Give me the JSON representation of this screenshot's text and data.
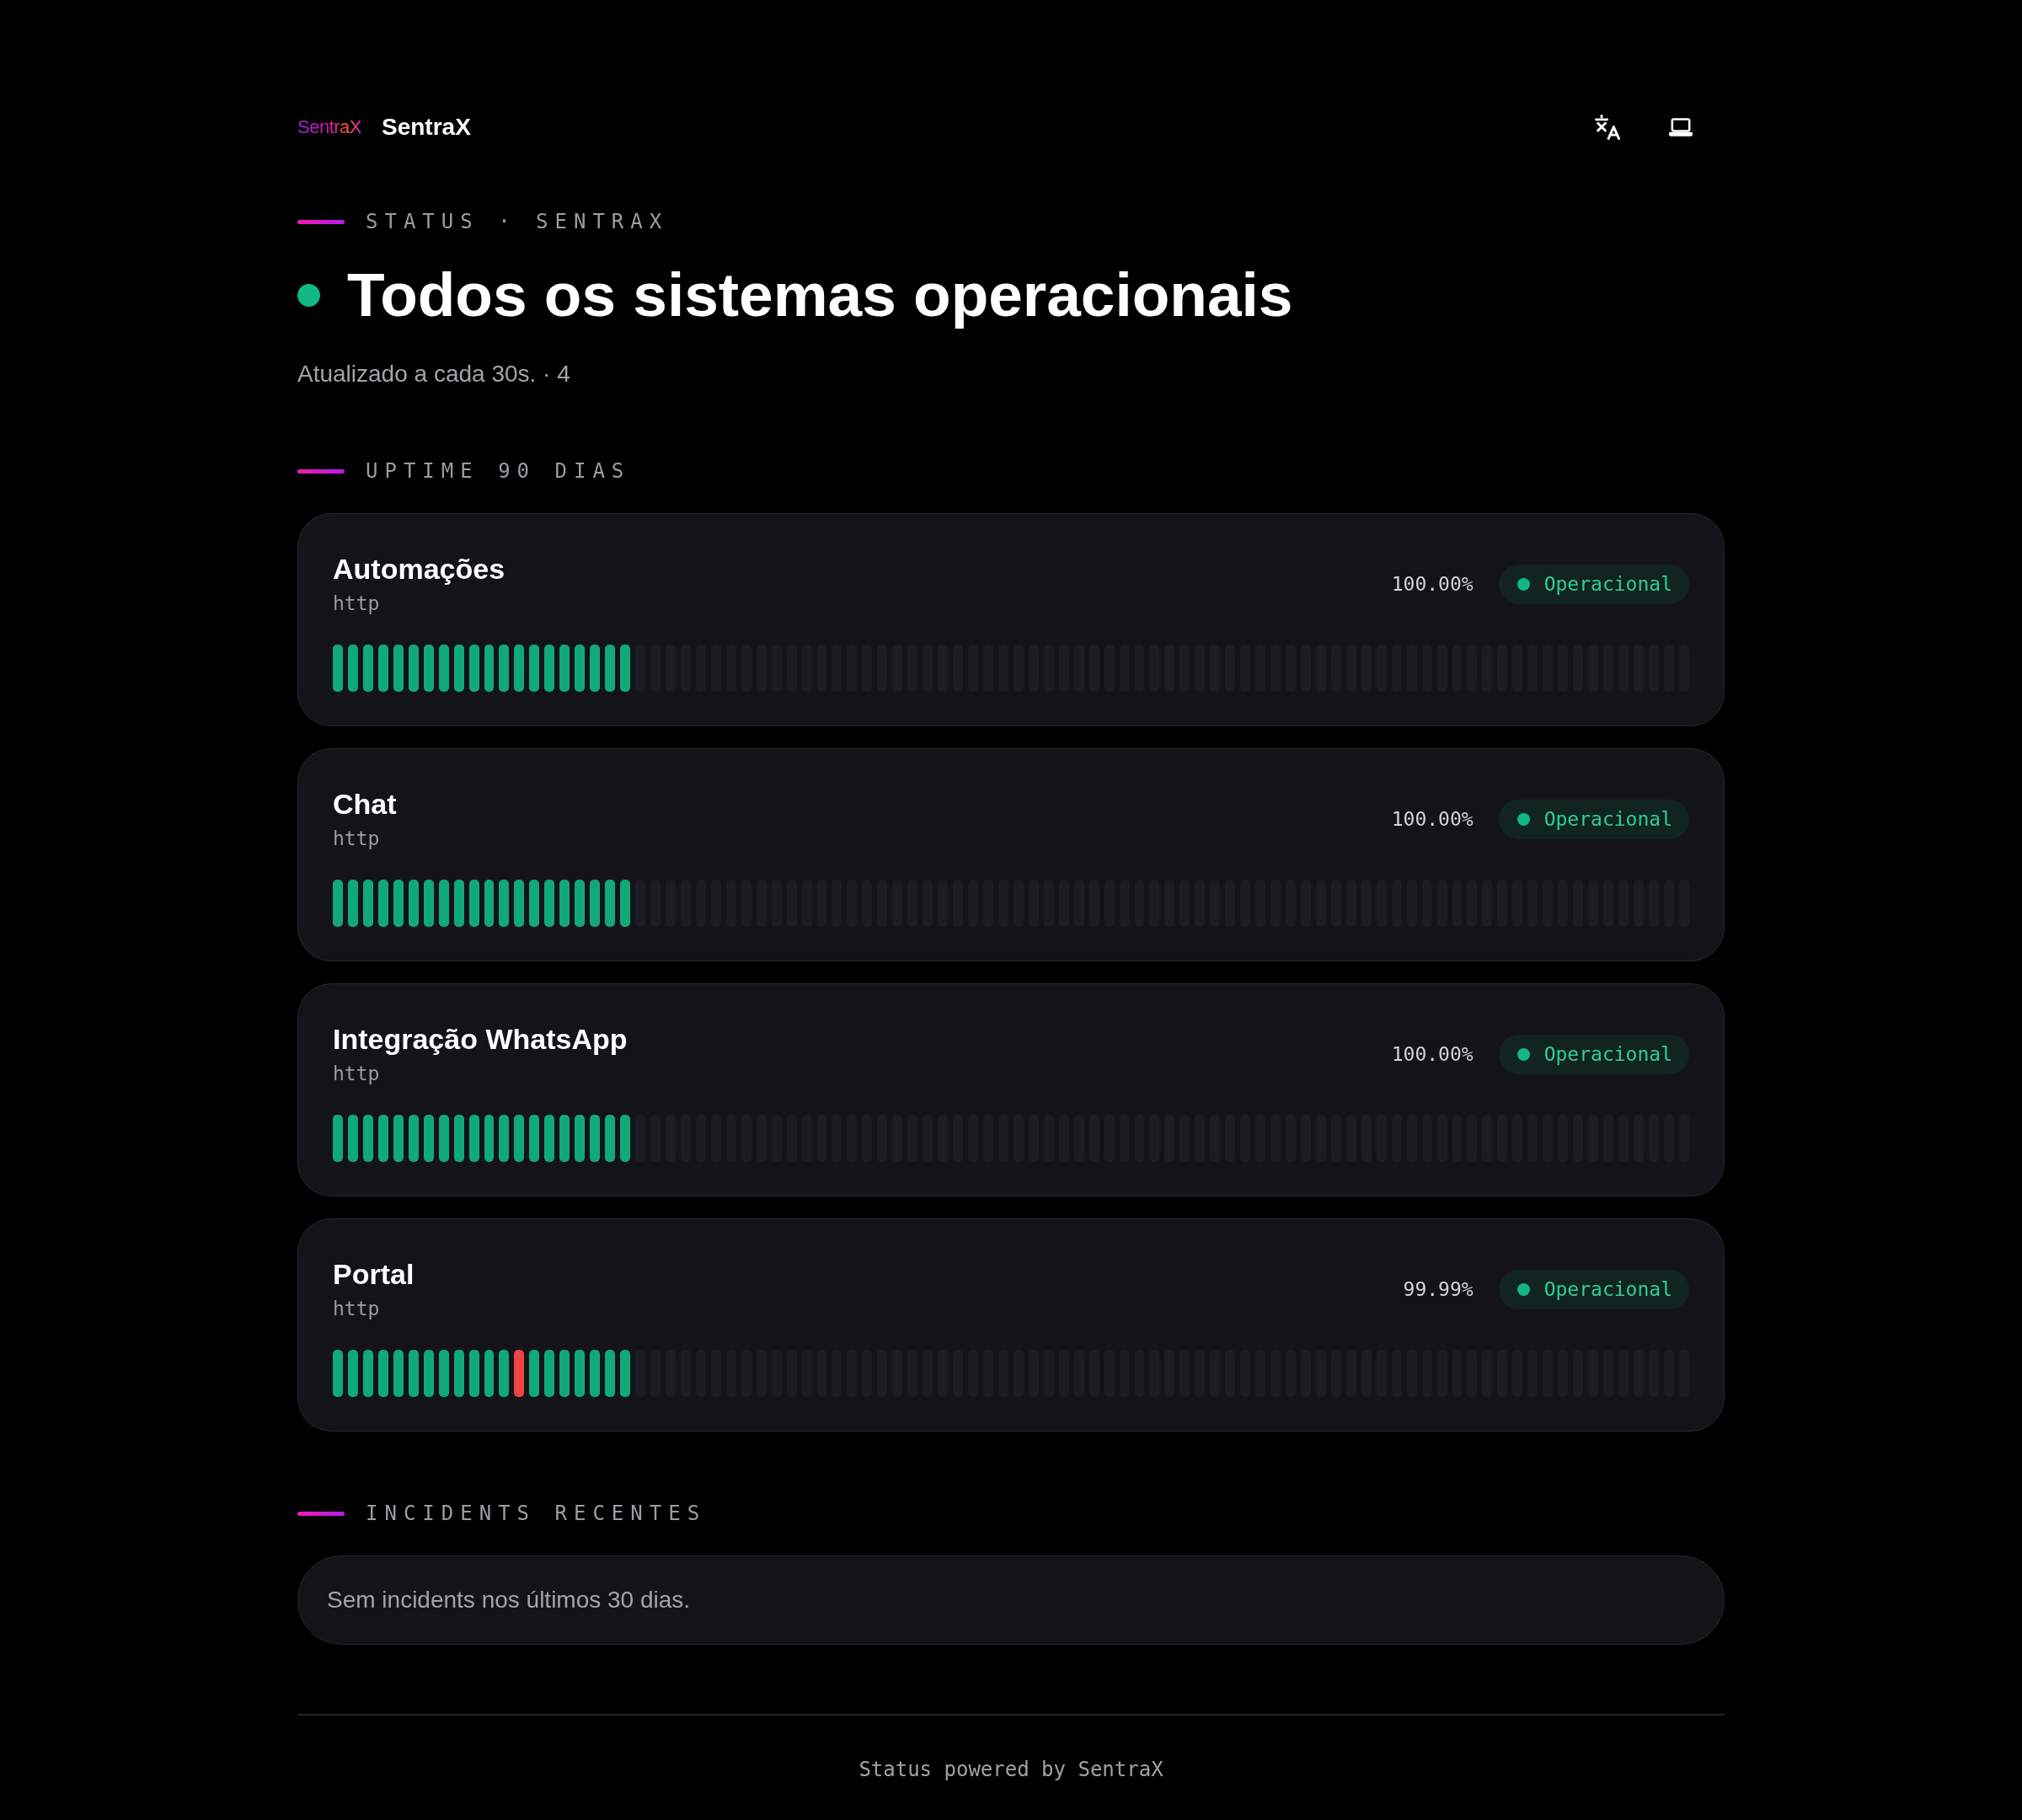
{
  "header": {
    "logo_text": "SentraX",
    "brand": "SentraX"
  },
  "status": {
    "label": "STATUS · SENTRAX",
    "kind": "operational",
    "title": "Todos os sistemas operacionais",
    "subtitle": "Atualizado a cada 30s. · 4"
  },
  "uptime": {
    "label": "UPTIME 90 DIAS",
    "services": [
      {
        "name": "Automações",
        "type": "http",
        "uptime": "100.00%",
        "status": {
          "kind": "operational",
          "label": "Operacional"
        },
        "days": [
          {
            "kind": "up"
          },
          {
            "kind": "up"
          },
          {
            "kind": "up"
          },
          {
            "kind": "up"
          },
          {
            "kind": "up"
          },
          {
            "kind": "up"
          },
          {
            "kind": "up"
          },
          {
            "kind": "up"
          },
          {
            "kind": "up"
          },
          {
            "kind": "up"
          },
          {
            "kind": "up"
          },
          {
            "kind": "up"
          },
          {
            "kind": "up"
          },
          {
            "kind": "up"
          },
          {
            "kind": "up"
          },
          {
            "kind": "up"
          },
          {
            "kind": "up"
          },
          {
            "kind": "up"
          },
          {
            "kind": "up"
          },
          {
            "kind": "up"
          },
          {
            "kind": "none"
          },
          {
            "kind": "none"
          },
          {
            "kind": "none"
          },
          {
            "kind": "none"
          },
          {
            "kind": "none"
          },
          {
            "kind": "none"
          },
          {
            "kind": "none"
          },
          {
            "kind": "none"
          },
          {
            "kind": "none"
          },
          {
            "kind": "none"
          },
          {
            "kind": "none"
          },
          {
            "kind": "none"
          },
          {
            "kind": "none"
          },
          {
            "kind": "none"
          },
          {
            "kind": "none"
          },
          {
            "kind": "none"
          },
          {
            "kind": "none"
          },
          {
            "kind": "none"
          },
          {
            "kind": "none"
          },
          {
            "kind": "none"
          },
          {
            "kind": "none"
          },
          {
            "kind": "none"
          },
          {
            "kind": "none"
          },
          {
            "kind": "none"
          },
          {
            "kind": "none"
          },
          {
            "kind": "none"
          },
          {
            "kind": "none"
          },
          {
            "kind": "none"
          },
          {
            "kind": "none"
          },
          {
            "kind": "none"
          },
          {
            "kind": "none"
          },
          {
            "kind": "none"
          },
          {
            "kind": "none"
          },
          {
            "kind": "none"
          },
          {
            "kind": "none"
          },
          {
            "kind": "none"
          },
          {
            "kind": "none"
          },
          {
            "kind": "none"
          },
          {
            "kind": "none"
          },
          {
            "kind": "none"
          },
          {
            "kind": "none"
          },
          {
            "kind": "none"
          },
          {
            "kind": "none"
          },
          {
            "kind": "none"
          },
          {
            "kind": "none"
          },
          {
            "kind": "none"
          },
          {
            "kind": "none"
          },
          {
            "kind": "none"
          },
          {
            "kind": "none"
          },
          {
            "kind": "none"
          },
          {
            "kind": "none"
          },
          {
            "kind": "none"
          },
          {
            "kind": "none"
          },
          {
            "kind": "none"
          },
          {
            "kind": "none"
          },
          {
            "kind": "none"
          },
          {
            "kind": "none"
          },
          {
            "kind": "none"
          },
          {
            "kind": "none"
          },
          {
            "kind": "none"
          },
          {
            "kind": "none"
          },
          {
            "kind": "none"
          },
          {
            "kind": "none"
          },
          {
            "kind": "none"
          },
          {
            "kind": "none"
          },
          {
            "kind": "none"
          },
          {
            "kind": "none"
          },
          {
            "kind": "none"
          },
          {
            "kind": "none"
          },
          {
            "kind": "none"
          }
        ]
      },
      {
        "name": "Chat",
        "type": "http",
        "uptime": "100.00%",
        "status": {
          "kind": "operational",
          "label": "Operacional"
        },
        "days": [
          {
            "kind": "up"
          },
          {
            "kind": "up"
          },
          {
            "kind": "up"
          },
          {
            "kind": "up"
          },
          {
            "kind": "up"
          },
          {
            "kind": "up"
          },
          {
            "kind": "up"
          },
          {
            "kind": "up"
          },
          {
            "kind": "up"
          },
          {
            "kind": "up"
          },
          {
            "kind": "up"
          },
          {
            "kind": "up"
          },
          {
            "kind": "up"
          },
          {
            "kind": "up"
          },
          {
            "kind": "up"
          },
          {
            "kind": "up"
          },
          {
            "kind": "up"
          },
          {
            "kind": "up"
          },
          {
            "kind": "up"
          },
          {
            "kind": "up"
          },
          {
            "kind": "none"
          },
          {
            "kind": "none"
          },
          {
            "kind": "none"
          },
          {
            "kind": "none"
          },
          {
            "kind": "none"
          },
          {
            "kind": "none"
          },
          {
            "kind": "none"
          },
          {
            "kind": "none"
          },
          {
            "kind": "none"
          },
          {
            "kind": "none"
          },
          {
            "kind": "none"
          },
          {
            "kind": "none"
          },
          {
            "kind": "none"
          },
          {
            "kind": "none"
          },
          {
            "kind": "none"
          },
          {
            "kind": "none"
          },
          {
            "kind": "none"
          },
          {
            "kind": "none"
          },
          {
            "kind": "none"
          },
          {
            "kind": "none"
          },
          {
            "kind": "none"
          },
          {
            "kind": "none"
          },
          {
            "kind": "none"
          },
          {
            "kind": "none"
          },
          {
            "kind": "none"
          },
          {
            "kind": "none"
          },
          {
            "kind": "none"
          },
          {
            "kind": "none"
          },
          {
            "kind": "none"
          },
          {
            "kind": "none"
          },
          {
            "kind": "none"
          },
          {
            "kind": "none"
          },
          {
            "kind": "none"
          },
          {
            "kind": "none"
          },
          {
            "kind": "none"
          },
          {
            "kind": "none"
          },
          {
            "kind": "none"
          },
          {
            "kind": "none"
          },
          {
            "kind": "none"
          },
          {
            "kind": "none"
          },
          {
            "kind": "none"
          },
          {
            "kind": "none"
          },
          {
            "kind": "none"
          },
          {
            "kind": "none"
          },
          {
            "kind": "none"
          },
          {
            "kind": "none"
          },
          {
            "kind": "none"
          },
          {
            "kind": "none"
          },
          {
            "kind": "none"
          },
          {
            "kind": "none"
          },
          {
            "kind": "none"
          },
          {
            "kind": "none"
          },
          {
            "kind": "none"
          },
          {
            "kind": "none"
          },
          {
            "kind": "none"
          },
          {
            "kind": "none"
          },
          {
            "kind": "none"
          },
          {
            "kind": "none"
          },
          {
            "kind": "none"
          },
          {
            "kind": "none"
          },
          {
            "kind": "none"
          },
          {
            "kind": "none"
          },
          {
            "kind": "none"
          },
          {
            "kind": "none"
          },
          {
            "kind": "none"
          },
          {
            "kind": "none"
          },
          {
            "kind": "none"
          },
          {
            "kind": "none"
          },
          {
            "kind": "none"
          },
          {
            "kind": "none"
          }
        ]
      },
      {
        "name": "Integração WhatsApp",
        "type": "http",
        "uptime": "100.00%",
        "status": {
          "kind": "operational",
          "label": "Operacional"
        },
        "days": [
          {
            "kind": "up"
          },
          {
            "kind": "up"
          },
          {
            "kind": "up"
          },
          {
            "kind": "up"
          },
          {
            "kind": "up"
          },
          {
            "kind": "up"
          },
          {
            "kind": "up"
          },
          {
            "kind": "up"
          },
          {
            "kind": "up"
          },
          {
            "kind": "up"
          },
          {
            "kind": "up"
          },
          {
            "kind": "up"
          },
          {
            "kind": "up"
          },
          {
            "kind": "up"
          },
          {
            "kind": "up"
          },
          {
            "kind": "up"
          },
          {
            "kind": "up"
          },
          {
            "kind": "up"
          },
          {
            "kind": "up"
          },
          {
            "kind": "up"
          },
          {
            "kind": "none"
          },
          {
            "kind": "none"
          },
          {
            "kind": "none"
          },
          {
            "kind": "none"
          },
          {
            "kind": "none"
          },
          {
            "kind": "none"
          },
          {
            "kind": "none"
          },
          {
            "kind": "none"
          },
          {
            "kind": "none"
          },
          {
            "kind": "none"
          },
          {
            "kind": "none"
          },
          {
            "kind": "none"
          },
          {
            "kind": "none"
          },
          {
            "kind": "none"
          },
          {
            "kind": "none"
          },
          {
            "kind": "none"
          },
          {
            "kind": "none"
          },
          {
            "kind": "none"
          },
          {
            "kind": "none"
          },
          {
            "kind": "none"
          },
          {
            "kind": "none"
          },
          {
            "kind": "none"
          },
          {
            "kind": "none"
          },
          {
            "kind": "none"
          },
          {
            "kind": "none"
          },
          {
            "kind": "none"
          },
          {
            "kind": "none"
          },
          {
            "kind": "none"
          },
          {
            "kind": "none"
          },
          {
            "kind": "none"
          },
          {
            "kind": "none"
          },
          {
            "kind": "none"
          },
          {
            "kind": "none"
          },
          {
            "kind": "none"
          },
          {
            "kind": "none"
          },
          {
            "kind": "none"
          },
          {
            "kind": "none"
          },
          {
            "kind": "none"
          },
          {
            "kind": "none"
          },
          {
            "kind": "none"
          },
          {
            "kind": "none"
          },
          {
            "kind": "none"
          },
          {
            "kind": "none"
          },
          {
            "kind": "none"
          },
          {
            "kind": "none"
          },
          {
            "kind": "none"
          },
          {
            "kind": "none"
          },
          {
            "kind": "none"
          },
          {
            "kind": "none"
          },
          {
            "kind": "none"
          },
          {
            "kind": "none"
          },
          {
            "kind": "none"
          },
          {
            "kind": "none"
          },
          {
            "kind": "none"
          },
          {
            "kind": "none"
          },
          {
            "kind": "none"
          },
          {
            "kind": "none"
          },
          {
            "kind": "none"
          },
          {
            "kind": "none"
          },
          {
            "kind": "none"
          },
          {
            "kind": "none"
          },
          {
            "kind": "none"
          },
          {
            "kind": "none"
          },
          {
            "kind": "none"
          },
          {
            "kind": "none"
          },
          {
            "kind": "none"
          },
          {
            "kind": "none"
          },
          {
            "kind": "none"
          },
          {
            "kind": "none"
          },
          {
            "kind": "none"
          }
        ]
      },
      {
        "name": "Portal",
        "type": "http",
        "uptime": "99.99%",
        "status": {
          "kind": "operational",
          "label": "Operacional"
        },
        "days": [
          {
            "kind": "up"
          },
          {
            "kind": "up"
          },
          {
            "kind": "up"
          },
          {
            "kind": "up"
          },
          {
            "kind": "up"
          },
          {
            "kind": "up"
          },
          {
            "kind": "up"
          },
          {
            "kind": "up"
          },
          {
            "kind": "up"
          },
          {
            "kind": "up"
          },
          {
            "kind": "up"
          },
          {
            "kind": "up"
          },
          {
            "kind": "down"
          },
          {
            "kind": "up"
          },
          {
            "kind": "up"
          },
          {
            "kind": "up"
          },
          {
            "kind": "up"
          },
          {
            "kind": "up"
          },
          {
            "kind": "up"
          },
          {
            "kind": "up"
          },
          {
            "kind": "none"
          },
          {
            "kind": "none"
          },
          {
            "kind": "none"
          },
          {
            "kind": "none"
          },
          {
            "kind": "none"
          },
          {
            "kind": "none"
          },
          {
            "kind": "none"
          },
          {
            "kind": "none"
          },
          {
            "kind": "none"
          },
          {
            "kind": "none"
          },
          {
            "kind": "none"
          },
          {
            "kind": "none"
          },
          {
            "kind": "none"
          },
          {
            "kind": "none"
          },
          {
            "kind": "none"
          },
          {
            "kind": "none"
          },
          {
            "kind": "none"
          },
          {
            "kind": "none"
          },
          {
            "kind": "none"
          },
          {
            "kind": "none"
          },
          {
            "kind": "none"
          },
          {
            "kind": "none"
          },
          {
            "kind": "none"
          },
          {
            "kind": "none"
          },
          {
            "kind": "none"
          },
          {
            "kind": "none"
          },
          {
            "kind": "none"
          },
          {
            "kind": "none"
          },
          {
            "kind": "none"
          },
          {
            "kind": "none"
          },
          {
            "kind": "none"
          },
          {
            "kind": "none"
          },
          {
            "kind": "none"
          },
          {
            "kind": "none"
          },
          {
            "kind": "none"
          },
          {
            "kind": "none"
          },
          {
            "kind": "none"
          },
          {
            "kind": "none"
          },
          {
            "kind": "none"
          },
          {
            "kind": "none"
          },
          {
            "kind": "none"
          },
          {
            "kind": "none"
          },
          {
            "kind": "none"
          },
          {
            "kind": "none"
          },
          {
            "kind": "none"
          },
          {
            "kind": "none"
          },
          {
            "kind": "none"
          },
          {
            "kind": "none"
          },
          {
            "kind": "none"
          },
          {
            "kind": "none"
          },
          {
            "kind": "none"
          },
          {
            "kind": "none"
          },
          {
            "kind": "none"
          },
          {
            "kind": "none"
          },
          {
            "kind": "none"
          },
          {
            "kind": "none"
          },
          {
            "kind": "none"
          },
          {
            "kind": "none"
          },
          {
            "kind": "none"
          },
          {
            "kind": "none"
          },
          {
            "kind": "none"
          },
          {
            "kind": "none"
          },
          {
            "kind": "none"
          },
          {
            "kind": "none"
          },
          {
            "kind": "none"
          },
          {
            "kind": "none"
          },
          {
            "kind": "none"
          },
          {
            "kind": "none"
          },
          {
            "kind": "none"
          },
          {
            "kind": "none"
          }
        ]
      }
    ]
  },
  "incidents": {
    "label": "INCIDENTS RECENTES",
    "empty_message": "Sem incidents nos últimos 30 dias."
  },
  "footer": {
    "text": "Status powered by SentraX"
  }
}
